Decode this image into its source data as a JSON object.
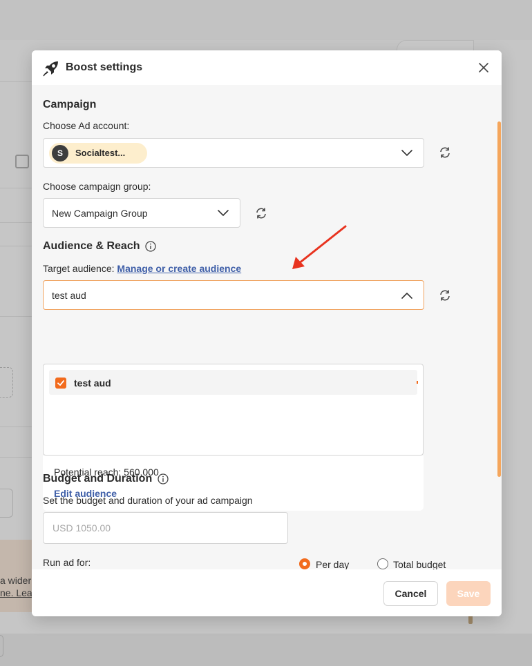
{
  "modal": {
    "title": "Boost settings",
    "icons": {
      "header": "rocket-icon",
      "close": "close-icon"
    }
  },
  "campaign": {
    "title": "Campaign",
    "ad_account_label": "Choose Ad account:",
    "ad_account": {
      "avatar_letter": "S",
      "name": "Socialtest..."
    },
    "group_label": "Choose campaign group:",
    "group_value": "New Campaign Group"
  },
  "audience": {
    "title": "Audience & Reach",
    "target_label": "Target audience:",
    "manage_link": "Manage or create audience",
    "selected": "test aud",
    "options": [
      {
        "label": "test aud",
        "checked": true
      }
    ],
    "potential_reach": "Potential reach: 560,000",
    "edit_link": "Edit audience"
  },
  "budget": {
    "title": "Budget and Duration",
    "description": "Set the budget and duration of your ad campaign",
    "amount_placeholder": "USD 1050.00",
    "per_day_label": "Per day",
    "total_label": "Total budget",
    "selected_mode": "per_day",
    "run_label": "Run ad for:"
  },
  "footer": {
    "cancel_label": "Cancel",
    "save_label": "Save"
  },
  "background": {
    "banner_text_line1": "a wider",
    "banner_text_line2": "ne. Lea"
  },
  "colors": {
    "accent": "#f26b1d",
    "link": "#3f5fa8",
    "chip": "#fdeecd",
    "save_disabled": "#fcd5bc",
    "annotation_arrow": "#e8331f"
  }
}
